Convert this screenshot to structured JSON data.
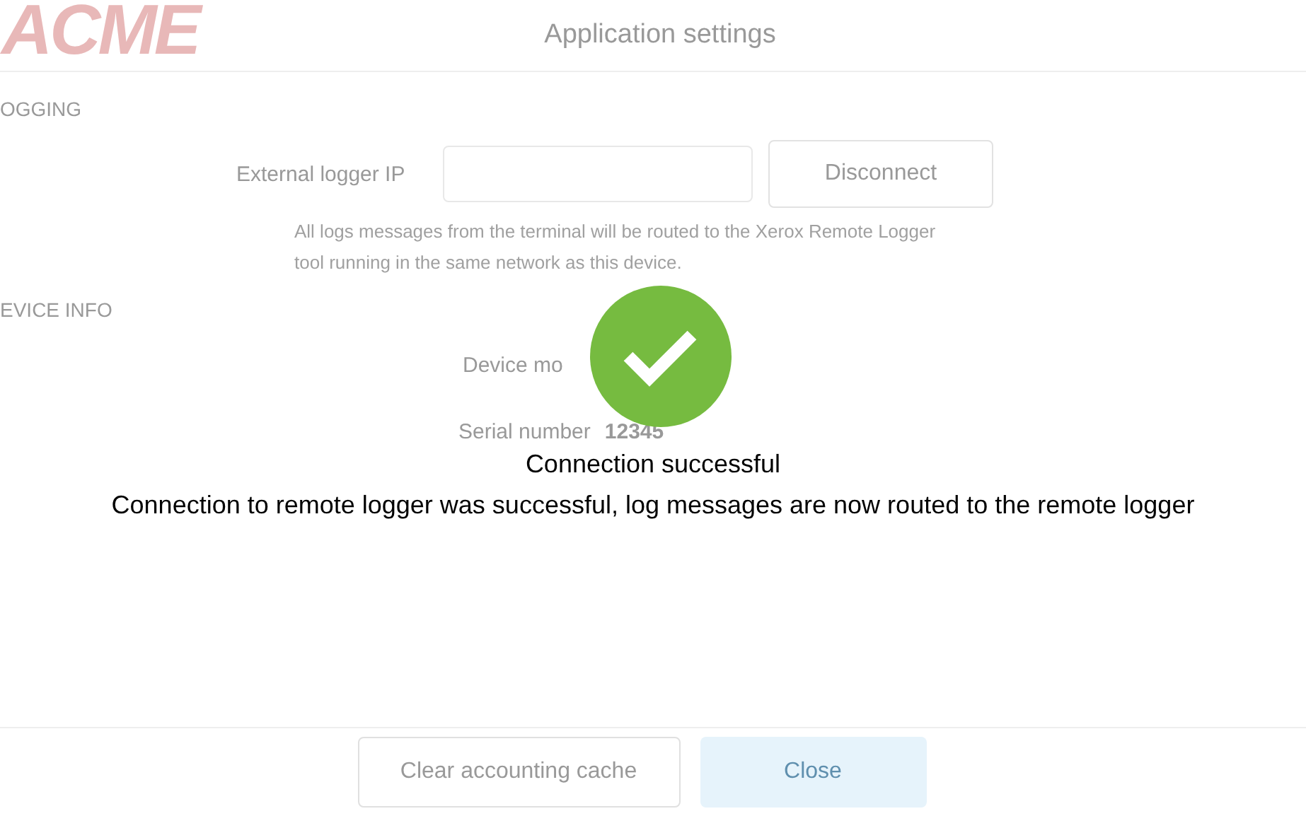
{
  "logo": "ACME",
  "window": {
    "title": "Application settings"
  },
  "logging": {
    "heading": "OGGING",
    "label": "External logger IP",
    "button": "Disconnect",
    "description": "All logs messages from the terminal will be routed to the Xerox Remote Logger tool running in the same network as this device."
  },
  "device_info": {
    "heading": "EVICE INFO",
    "fields": [
      {
        "label": "Device mo"
      },
      {
        "label": "Serial number",
        "value": "12345"
      }
    ]
  },
  "footer_buttons": [
    {
      "label": "Clear accounting cache",
      "kind": "secondary"
    },
    {
      "label": "Close",
      "kind": "primary"
    }
  ],
  "notification": {
    "title": "Connection successful",
    "message": "Connection to remote logger was successful, log messages are now routed to the remote logger"
  }
}
